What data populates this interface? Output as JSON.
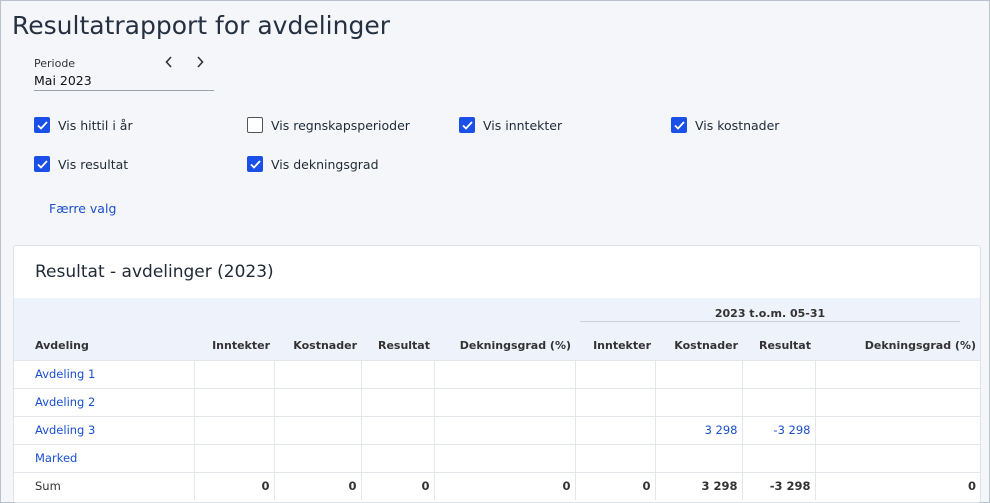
{
  "page": {
    "title": "Resultatrapport for avdelinger"
  },
  "period": {
    "label": "Periode",
    "value": "Mai 2023"
  },
  "options": [
    {
      "label": "Vis hittil i år",
      "checked": true
    },
    {
      "label": "Vis regnskapsperioder",
      "checked": false
    },
    {
      "label": "Vis inntekter",
      "checked": true
    },
    {
      "label": "Vis kostnader",
      "checked": true
    },
    {
      "label": "Vis resultat",
      "checked": true
    },
    {
      "label": "Vis dekningsgrad",
      "checked": true
    }
  ],
  "fewer_link": "Færre valg",
  "report": {
    "title": "Resultat - avdelinger (2023)",
    "group_header": "2023 t.o.m. 05-31",
    "columns": [
      "Avdeling",
      "Inntekter",
      "Kostnader",
      "Resultat",
      "Dekningsgrad (%)",
      "Inntekter",
      "Kostnader",
      "Resultat",
      "Dekningsgrad (%)"
    ],
    "rows": [
      {
        "name": "Avdeling 1",
        "cells": [
          "",
          "",
          "",
          "",
          "",
          "",
          "",
          ""
        ]
      },
      {
        "name": "Avdeling 2",
        "cells": [
          "",
          "",
          "",
          "",
          "",
          "",
          "",
          ""
        ]
      },
      {
        "name": "Avdeling 3",
        "cells": [
          "",
          "",
          "",
          "",
          "",
          "3 298",
          "-3 298",
          ""
        ]
      },
      {
        "name": "Marked",
        "cells": [
          "",
          "",
          "",
          "",
          "",
          "",
          "",
          ""
        ]
      }
    ],
    "sum": {
      "name": "Sum",
      "cells": [
        "0",
        "0",
        "0",
        "0",
        "0",
        "3 298",
        "-3 298",
        "0"
      ]
    }
  }
}
